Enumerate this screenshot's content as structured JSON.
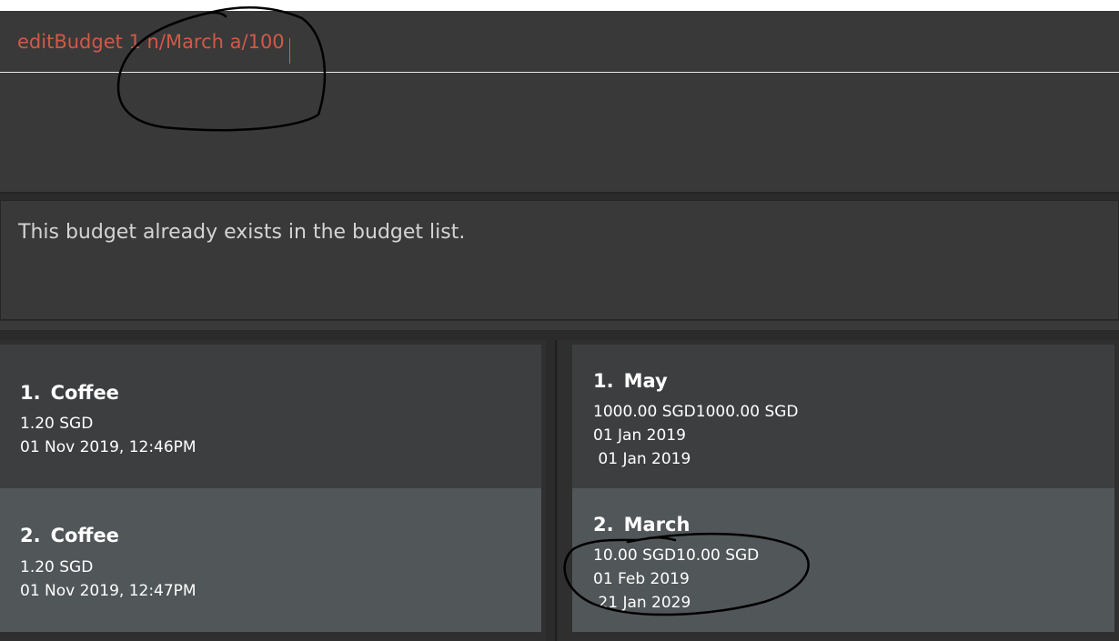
{
  "command": {
    "value": "editBudget 1 n/March a/100",
    "text_color": "#d05a45"
  },
  "result": {
    "message": "This budget already exists in the budget list."
  },
  "expenses": [
    {
      "index": "1.",
      "name": "Coffee",
      "amount": "1.20 SGD",
      "datetime": "01 Nov 2019, 12:46PM"
    },
    {
      "index": "2.",
      "name": "Coffee",
      "amount": "1.20 SGD",
      "datetime": "01 Nov 2019, 12:47PM"
    }
  ],
  "budgets": [
    {
      "index": "1.",
      "name": "May",
      "amount": "1000.00 SGD1000.00 SGD",
      "start": "01 Jan 2019",
      "end": " 01 Jan 2019"
    },
    {
      "index": "2.",
      "name": "March",
      "amount": "10.00 SGD10.00 SGD",
      "start": "01 Feb 2019",
      "end": " 21 Jan 2029"
    }
  ],
  "colors": {
    "background": "#2b2b2b",
    "panel": "#393939",
    "card_odd": "#3c3e3f",
    "card_even": "#515658",
    "annotation_ink": "#000000"
  }
}
